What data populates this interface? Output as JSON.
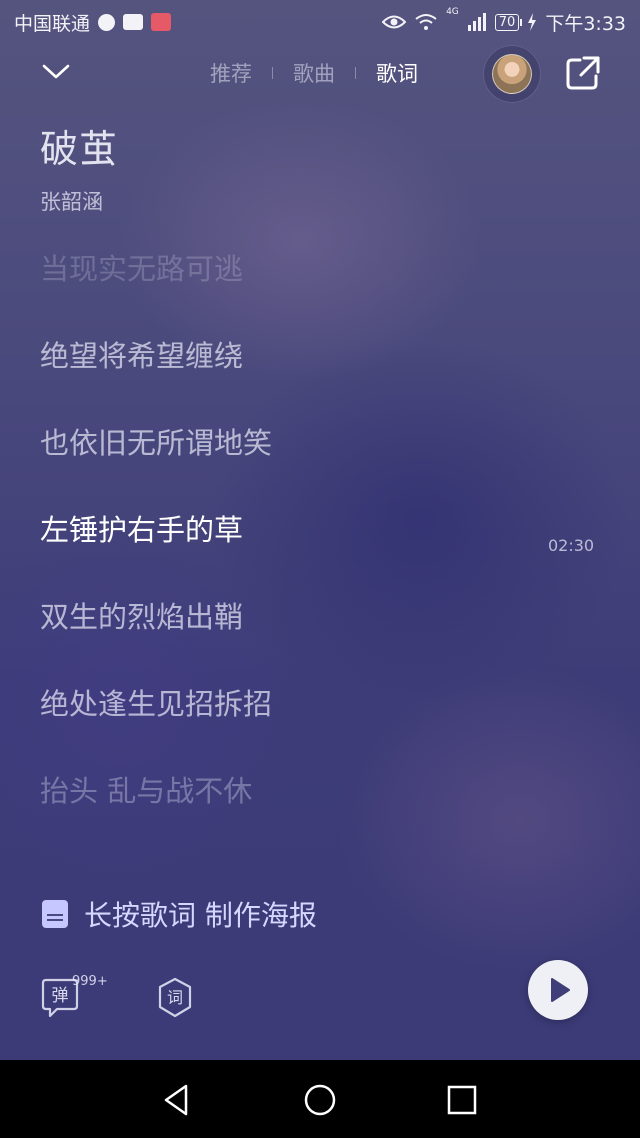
{
  "status_bar": {
    "carrier": "中国联通",
    "battery": "70",
    "network": "4G",
    "time": "下午3:33"
  },
  "nav": {
    "tabs": [
      {
        "label": "推荐",
        "active": false
      },
      {
        "label": "歌曲",
        "active": false
      },
      {
        "label": "歌词",
        "active": true
      }
    ]
  },
  "song": {
    "title": "破茧",
    "artist": "张韶涵"
  },
  "lyrics": {
    "lines": [
      {
        "text": "当现实无路可逃",
        "state": "faded"
      },
      {
        "text": "绝望将希望缠绕",
        "state": "normal"
      },
      {
        "text": "也依旧无所谓地笑",
        "state": "normal"
      },
      {
        "text": "左锤护右手的草",
        "state": "current"
      },
      {
        "text": "双生的烈焰出鞘",
        "state": "normal"
      },
      {
        "text": "绝处逢生见招拆招",
        "state": "normal"
      },
      {
        "text": "抬头 乱与战不休",
        "state": "dim"
      }
    ],
    "current_time": "02:30"
  },
  "poster": {
    "label": "长按歌词 制作海报"
  },
  "controls": {
    "danmaku_label": "弹",
    "danmaku_count": "999+",
    "lyric_setting_label": "词"
  },
  "colors": {
    "background": "#4b4a7d",
    "accent": "#c6c7ff",
    "play_button": "#efeff6"
  },
  "icons": [
    "chevron-down-icon",
    "share-icon",
    "poster-icon",
    "danmaku-icon",
    "lyric-setting-icon",
    "play-icon",
    "back-icon",
    "home-icon",
    "recent-apps-icon"
  ]
}
